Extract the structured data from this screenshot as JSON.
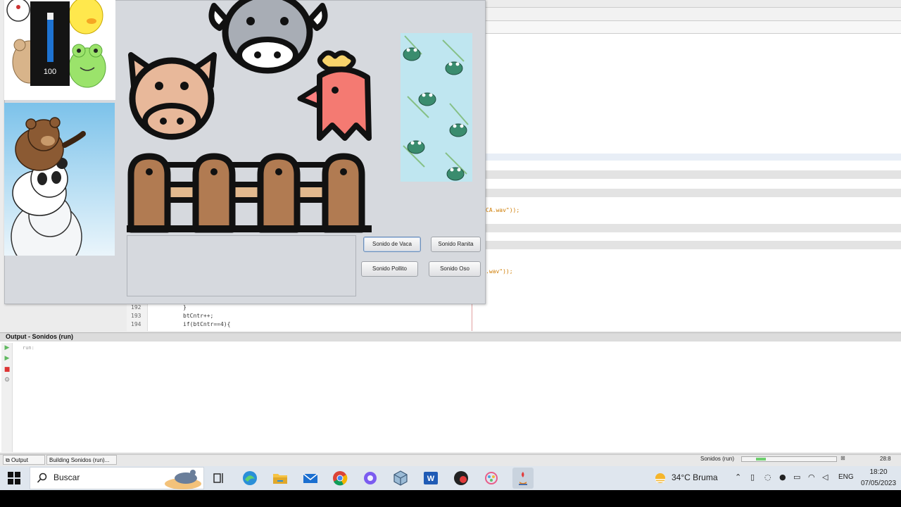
{
  "ide": {
    "code_lines": [
      {
        "num": "192",
        "text": "}"
      },
      {
        "num": "193",
        "text": "btCntr++;"
      },
      {
        "num": "194",
        "text": "if(btCntr==4){"
      }
    ],
    "snippet_1": "CA.wav\"));",
    "snippet_2": ".wav\"));"
  },
  "output": {
    "title": "Output - Sonidos (run)",
    "text": "run:"
  },
  "status_bar": {
    "tab_output": "Output",
    "tab_building": "Building Sonidos (run)...",
    "run_label": "Sonidos (run)",
    "position": "28:8",
    "progress": 0.15
  },
  "app": {
    "volume": {
      "value": "100",
      "level": 1.0
    },
    "buttons": {
      "vaca": "Sonido de Vaca",
      "ranita": "Sonido Ranita",
      "pollito": "Sonido Pollito",
      "oso": "Sonido Oso"
    }
  },
  "taskbar": {
    "search_placeholder": "Buscar",
    "weather": "34°C  Bruma",
    "language": "ENG",
    "time": "18:20",
    "date": "07/05/2023",
    "icons": [
      "windows-start-icon",
      "search-icon",
      "task-view-icon",
      "edge-icon",
      "file-explorer-icon",
      "mail-icon",
      "chrome-icon",
      "copilot-icon",
      "virtualbox-icon",
      "word-icon",
      "app-icon",
      "paint-icon",
      "java-icon"
    ]
  },
  "colors": {
    "accent": "#1e73d2",
    "app_bg": "#d6d9de",
    "taskbar_bg": "#dfe6ee"
  }
}
